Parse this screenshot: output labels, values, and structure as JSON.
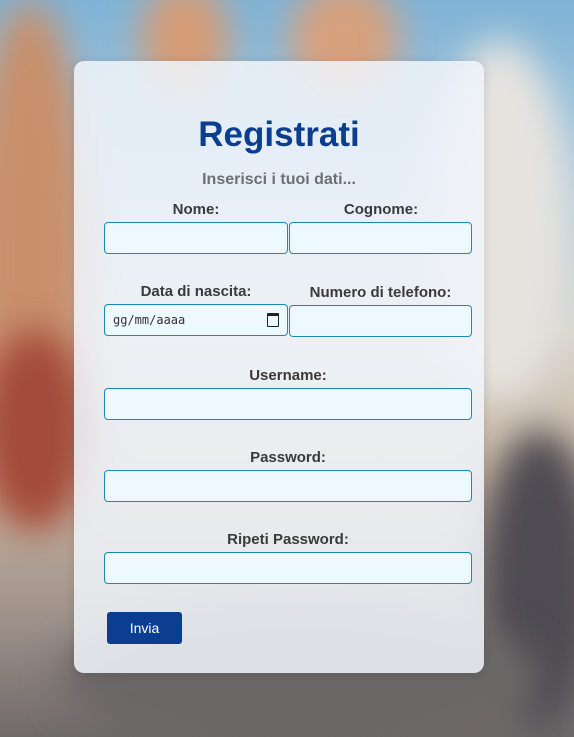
{
  "form": {
    "title": "Registrati",
    "subtitle": "Inserisci i tuoi dati...",
    "fields": {
      "nome": {
        "label": "Nome:",
        "value": ""
      },
      "cognome": {
        "label": "Cognome:",
        "value": ""
      },
      "data_nascita": {
        "label": "Data di nascita:",
        "value": "gg/mm/aaaa"
      },
      "telefono": {
        "label": "Numero di telefono:",
        "value": ""
      },
      "username": {
        "label": "Username:",
        "value": ""
      },
      "password": {
        "label": "Password:",
        "value": ""
      },
      "ripeti_password": {
        "label": "Ripeti Password:",
        "value": ""
      }
    },
    "submit_label": "Invia"
  },
  "colors": {
    "accent": "#0b3d91",
    "input_border": "#1a8bb5",
    "input_bg": "#eef8ff"
  },
  "icons": {
    "date_picker": "calendar-icon"
  }
}
